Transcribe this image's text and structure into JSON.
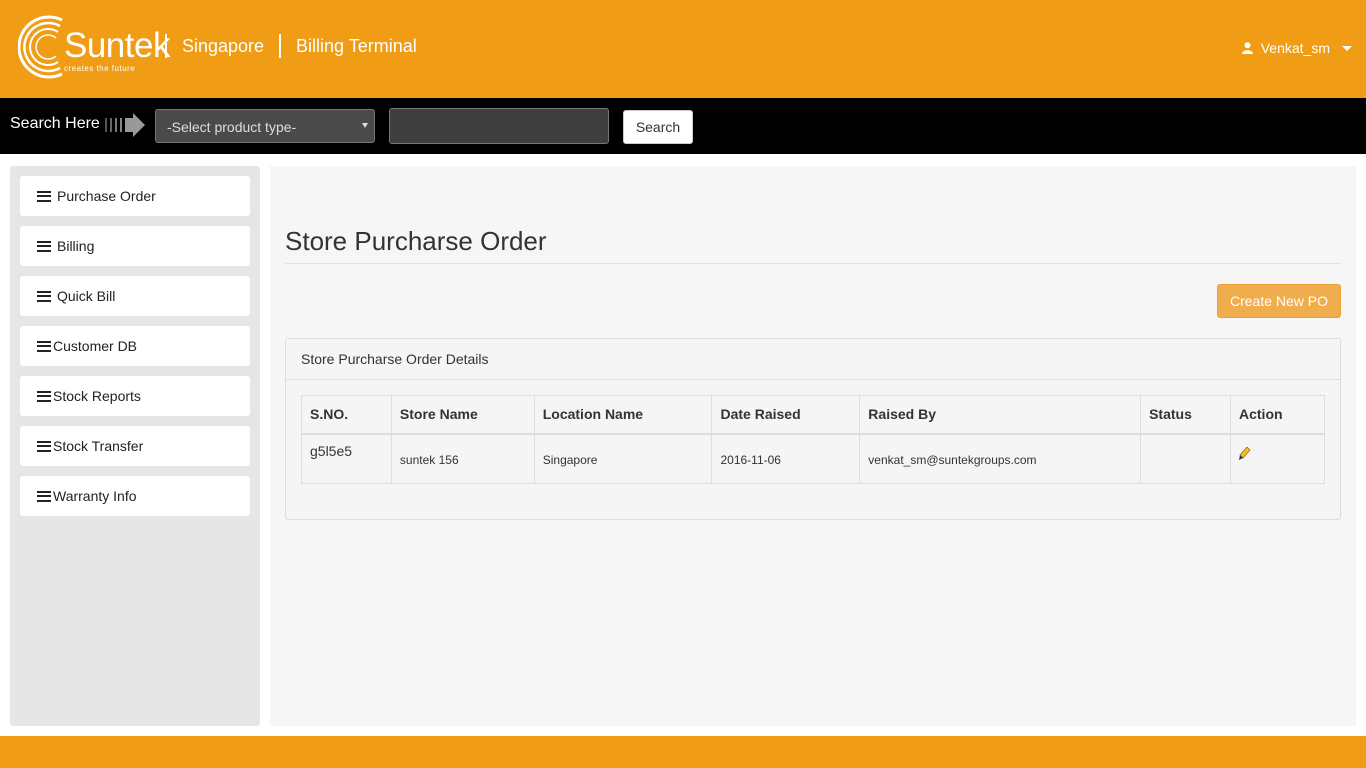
{
  "header": {
    "logo_text": "Suntek",
    "logo_tagline": "creates the future",
    "location": "Singapore",
    "app_name": "Billing Terminal",
    "user_name": "Venkat_sm"
  },
  "searchbar": {
    "label": "Search Here",
    "product_type_selected": "-Select product type-",
    "search_value": "",
    "search_button": "Search"
  },
  "sidebar": {
    "items": [
      {
        "label": "Purchase Order"
      },
      {
        "label": "Billing"
      },
      {
        "label": "Quick Bill"
      },
      {
        "label": "Customer DB"
      },
      {
        "label": "Stock Reports"
      },
      {
        "label": "Stock Transfer"
      },
      {
        "label": "Warranty Info"
      }
    ]
  },
  "main": {
    "title": "Store Purcharse Order",
    "create_button": "Create New PO",
    "panel_heading": "Store Purcharse Order Details",
    "table": {
      "columns": [
        "S.NO.",
        "Store Name",
        "Location Name",
        "Date Raised",
        "Raised By",
        "Status",
        "Action"
      ],
      "rows": [
        {
          "sno": "g5l5e5",
          "store_name": "suntek 156",
          "location_name": "Singapore",
          "date_raised": "2016-11-06",
          "raised_by": "venkat_sm@suntekgroups.com",
          "status": "",
          "action_icon": "pencil-icon"
        }
      ]
    }
  },
  "colors": {
    "brand_orange": "#f09c14",
    "button_warning": "#f0ad4e",
    "search_bar": "#000000"
  }
}
